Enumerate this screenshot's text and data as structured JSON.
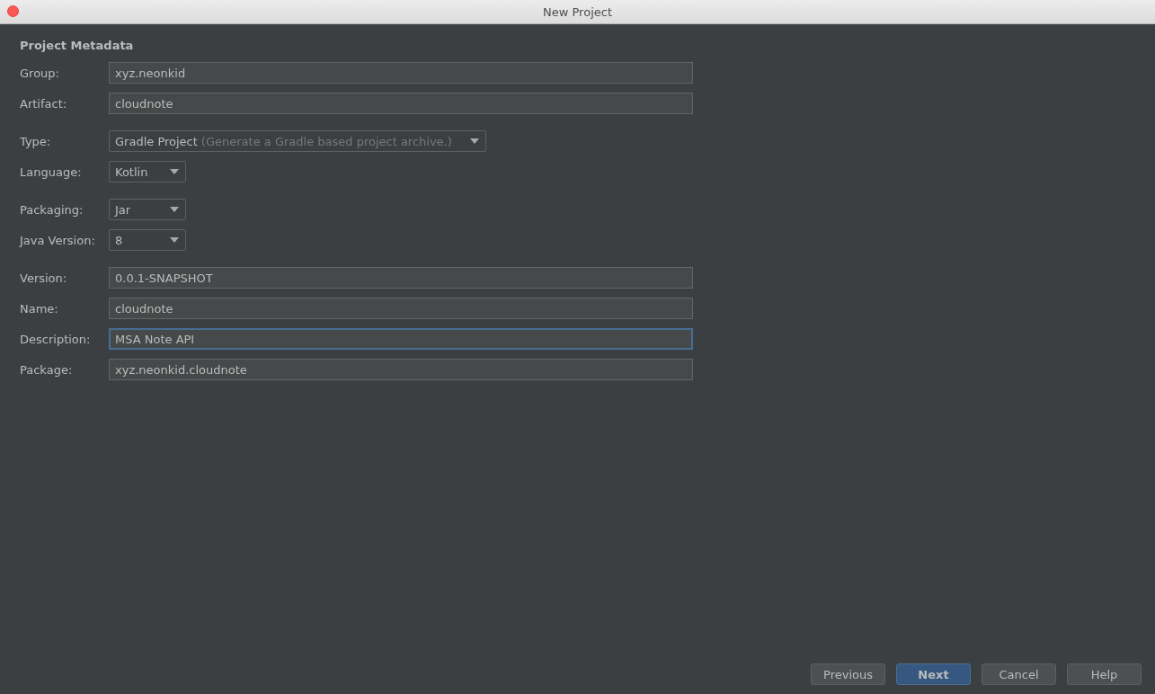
{
  "window": {
    "title": "New Project"
  },
  "section_title": "Project Metadata",
  "groups": [
    {
      "fields": [
        {
          "kind": "text",
          "label": "Group:",
          "value": "xyz.neonkid",
          "focused": false
        },
        {
          "kind": "text",
          "label": "Artifact:",
          "value": "cloudnote",
          "focused": false
        }
      ]
    },
    {
      "fields": [
        {
          "kind": "dropdown",
          "label": "Type:",
          "value": "Gradle Project",
          "hint": "(Generate a Gradle based project archive.)",
          "wide": true
        },
        {
          "kind": "dropdown",
          "label": "Language:",
          "value": "Kotlin",
          "wide": false
        }
      ]
    },
    {
      "fields": [
        {
          "kind": "dropdown",
          "label": "Packaging:",
          "value": "Jar",
          "wide": false
        },
        {
          "kind": "dropdown",
          "label": "Java Version:",
          "value": "8",
          "wide": false
        }
      ]
    },
    {
      "fields": [
        {
          "kind": "text",
          "label": "Version:",
          "value": "0.0.1-SNAPSHOT",
          "focused": false
        },
        {
          "kind": "text",
          "label": "Name:",
          "value": "cloudnote",
          "focused": false
        },
        {
          "kind": "text",
          "label": "Description:",
          "value": "MSA Note API",
          "focused": true
        },
        {
          "kind": "text",
          "label": "Package:",
          "value": "xyz.neonkid.cloudnote",
          "focused": false
        }
      ]
    }
  ],
  "buttons": [
    {
      "label": "Previous",
      "default": false
    },
    {
      "label": "Next",
      "default": true
    },
    {
      "label": "Cancel",
      "default": false
    },
    {
      "label": "Help",
      "default": false
    }
  ]
}
